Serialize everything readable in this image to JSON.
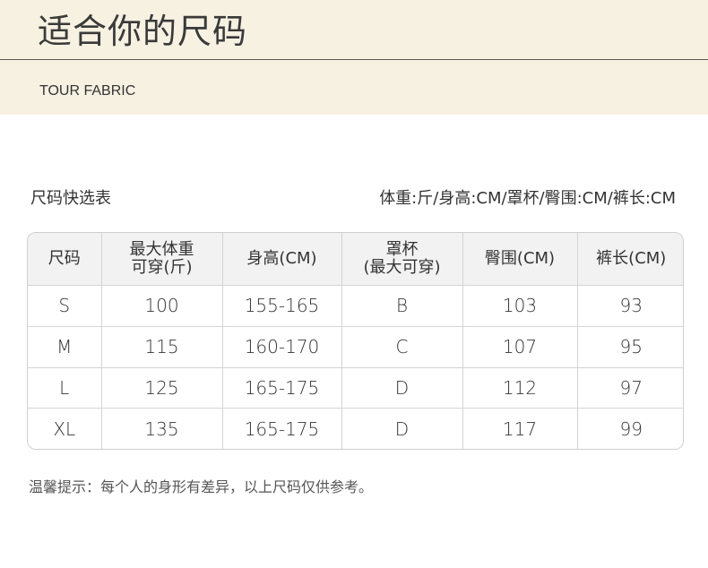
{
  "header": {
    "title": "适合你的尺码",
    "subtitle": "TOUR FABRIC"
  },
  "table_caption": "尺码快选表",
  "units_note": "体重:斤/身高:CM/罩杯/臀围:CM/裤长:CM",
  "table": {
    "headers": [
      [
        "尺码"
      ],
      [
        "最大体重",
        "可穿(斤)"
      ],
      [
        "身高(CM)"
      ],
      [
        "罩杯",
        "(最大可穿)"
      ],
      [
        "臀围(CM)"
      ],
      [
        "裤长(CM)"
      ]
    ],
    "rows": [
      [
        "S",
        "100",
        "155-165",
        "B",
        "103",
        "93"
      ],
      [
        "M",
        "115",
        "160-170",
        "C",
        "107",
        "95"
      ],
      [
        "L",
        "125",
        "165-175",
        "D",
        "112",
        "97"
      ],
      [
        "XL",
        "135",
        "165-175",
        "D",
        "117",
        "99"
      ]
    ]
  },
  "footer_note": "温馨提示：每个人的身形有差异，以上尺码仅供参考。"
}
